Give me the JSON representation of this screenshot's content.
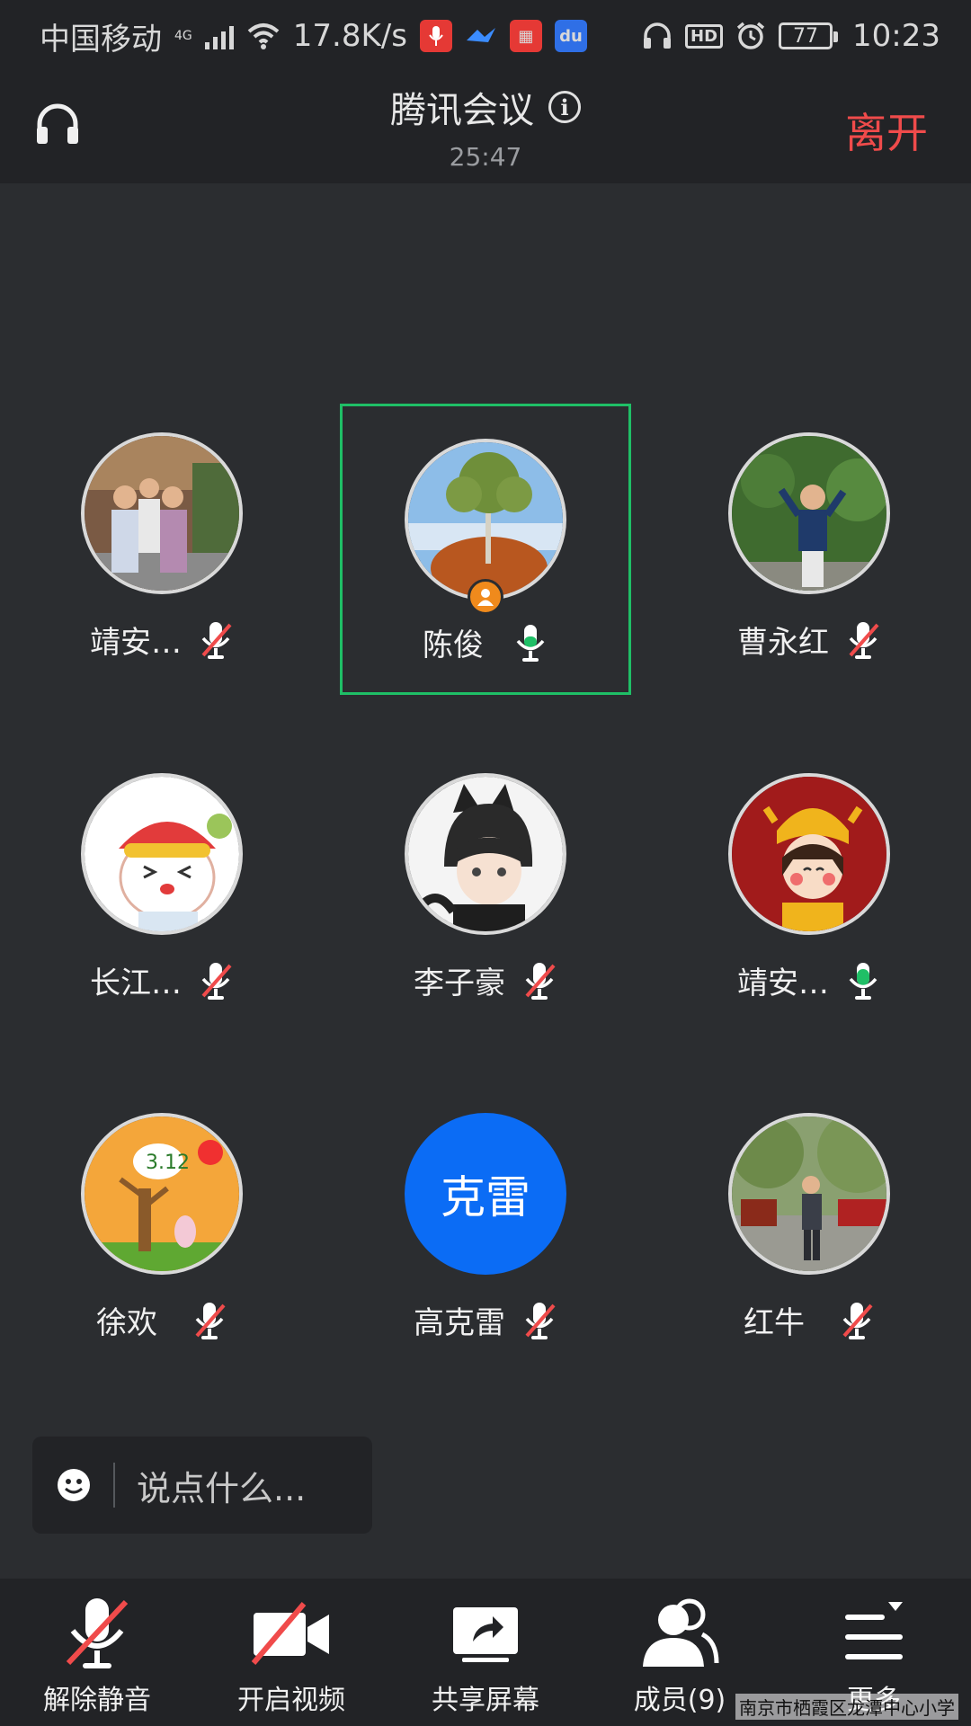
{
  "status_bar": {
    "carrier": "中国移动",
    "network": "4G",
    "speed": "17.8K/s",
    "battery": "77",
    "time": "10:23"
  },
  "header": {
    "title": "腾讯会议",
    "timer": "25:47",
    "leave_label": "离开"
  },
  "participants": [
    {
      "name": "靖安…",
      "muted": true,
      "avatar": "photo-family"
    },
    {
      "name": "陈俊",
      "muted": false,
      "speaking": true,
      "host": true,
      "avatar": "photo-tree"
    },
    {
      "name": "曹永红",
      "muted": true,
      "avatar": "photo-boy"
    },
    {
      "name": "长江…",
      "muted": true,
      "avatar": "cartoon-red-hat"
    },
    {
      "name": "李子豪",
      "muted": true,
      "avatar": "anime-cat-boy"
    },
    {
      "name": "靖安…",
      "muted": false,
      "avatar": "cartoon-girl"
    },
    {
      "name": "徐欢",
      "muted": true,
      "avatar": "drawing-tree"
    },
    {
      "name": "高克雷",
      "muted": true,
      "avatar_text": "克雷"
    },
    {
      "name": "红牛",
      "muted": true,
      "avatar": "photo-man"
    }
  ],
  "chat": {
    "placeholder": "说点什么..."
  },
  "toolbar": {
    "unmute_label": "解除静音",
    "video_label": "开启视频",
    "share_label": "共享屏幕",
    "members_label": "成员(9)",
    "more_label": "更多"
  },
  "watermark": "南京市栖霞区龙潭中心小学",
  "colors": {
    "background": "#2b2d30",
    "bar": "#222326",
    "leave": "#f04b4b",
    "speaking_border": "#1fbf66",
    "mic_active": "#1fbf66",
    "mute_slash": "#f04b4b",
    "avatar_blue": "#0b6cf5",
    "host_badge": "#f08a1c"
  }
}
